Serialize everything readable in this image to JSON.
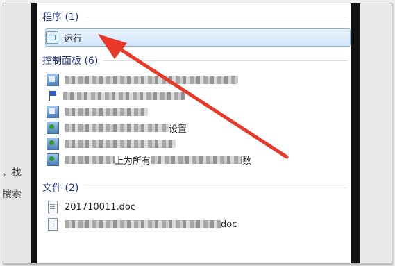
{
  "search_results": {
    "groups": {
      "programs": {
        "title": "程序 (1)",
        "items": [
          {
            "label": "运行",
            "icon": "run-icon",
            "selected": true
          }
        ]
      },
      "control_panel": {
        "title": "控制面板 (6)",
        "items": [
          {
            "visible_text": "",
            "icon": "control-panel-icon"
          },
          {
            "visible_text": "",
            "icon": "flag-icon"
          },
          {
            "visible_text": "",
            "icon": "control-panel-icon"
          },
          {
            "visible_text": "设置",
            "icon": "control-panel-icon"
          },
          {
            "visible_text": "",
            "icon": "control-panel-icon"
          },
          {
            "visible_text": "上为所有",
            "visible_text_2": "数",
            "icon": "control-panel-icon"
          }
        ]
      },
      "files": {
        "title": "文件 (2)",
        "items": [
          {
            "label": "201710011.doc",
            "icon": "document-icon"
          },
          {
            "visible_text": "doc",
            "icon": "document-icon"
          }
        ]
      }
    }
  },
  "background": {
    "left_text_1": "，找",
    "left_text_2": "搜索"
  },
  "colors": {
    "header_text": "#1e3287",
    "selection_border": "#88b3e2",
    "arrow": "#e83828"
  }
}
